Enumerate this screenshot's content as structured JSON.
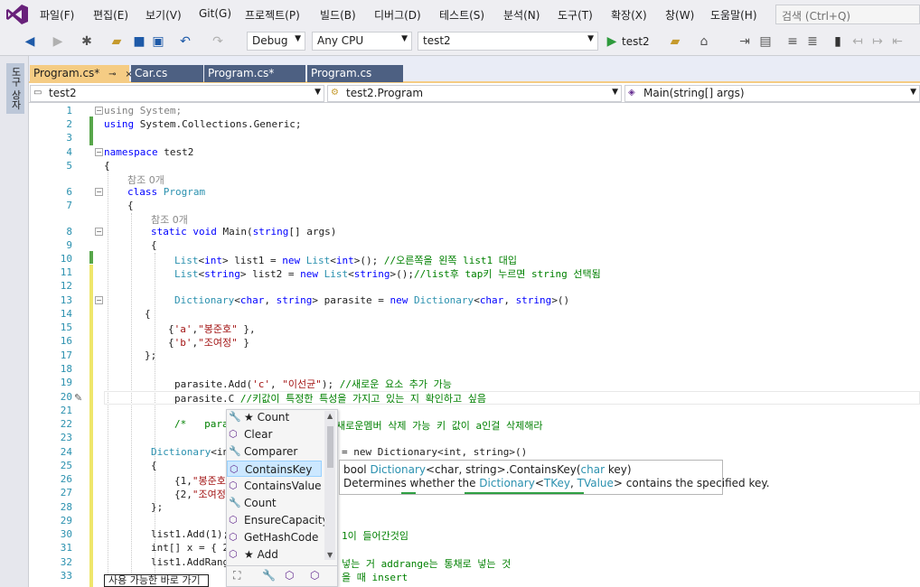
{
  "app": {
    "name": "Visual Studio"
  },
  "menu": {
    "items": [
      "파일(F)",
      "편집(E)",
      "보기(V)",
      "Git(G)",
      "프로젝트(P)",
      "빌드(B)",
      "디버그(D)",
      "테스트(S)",
      "분석(N)",
      "도구(T)",
      "확장(X)",
      "창(W)",
      "도움말(H)"
    ],
    "search_placeholder": "검색 (Ctrl+Q)"
  },
  "toolbar": {
    "config": "Debug",
    "platform": "Any CPU",
    "startup_project": "test2",
    "run_label": "test2"
  },
  "left_tool_window": {
    "label": "도구 상자"
  },
  "tabs": [
    {
      "label": "Program.cs*",
      "pin": "⊸",
      "close": "×",
      "active": true
    },
    {
      "label": "Car.cs",
      "active": false
    },
    {
      "label": "Program.cs*",
      "active": false
    },
    {
      "label": "Program.cs",
      "active": false
    }
  ],
  "nav": {
    "project": "test2",
    "type": "test2.Program",
    "member": "Main(string[] args)"
  },
  "code": {
    "line_numbers": [
      "1",
      "2",
      "3",
      "4",
      "5",
      "6",
      "7",
      "8",
      "9",
      "10",
      "11",
      "12",
      "13",
      "14",
      "15",
      "16",
      "17",
      "18",
      "19",
      "20",
      "21",
      "22",
      "23",
      "24",
      "25",
      "26",
      "27",
      "28",
      "29",
      "30",
      "31",
      "32",
      "33"
    ],
    "ref_count": "참조 0개",
    "l1_kw": "using",
    "l1_rest": " System;",
    "l2_kw": "using",
    "l2_rest": " System.Collections.Generic;",
    "l4_kw": "namespace",
    "l4_rest": " test2",
    "brace_open": "{",
    "brace_close": "}",
    "brace_close_semi": "};",
    "l6_kw": "class",
    "l6_ty": " Program",
    "l8_a": "static",
    "l8_b": " void",
    "l8_c": " Main(",
    "l8_d": "string",
    "l8_e": "[] args)",
    "l10_a": "List",
    "l10_b": "<",
    "l10_c": "int",
    "l10_d": "> list1 = ",
    "l10_e": "new",
    "l10_f": " List",
    "l10_g": "<",
    "l10_h": "int",
    "l10_i": ">(); ",
    "l10_cm": "//오른쪽을 왼쪽 list1 대입",
    "l11_a": "List",
    "l11_b": "<",
    "l11_c": "string",
    "l11_d": "> list2 = ",
    "l11_e": "new",
    "l11_f": " List",
    "l11_g": "<",
    "l11_h": "string",
    "l11_i": ">();",
    "l11_cm": "//list후 tap키 누르면 string 선택됨",
    "l13_a": "Dictionary",
    "l13_b": "<",
    "l13_c": "char",
    "l13_d": ", ",
    "l13_e": "string",
    "l13_f": "> parasite = ",
    "l13_g": "new",
    "l13_h": " Dictionary",
    "l13_i": "<",
    "l13_j": "char",
    "l13_k": ", ",
    "l13_l": "string",
    "l13_m": ">()",
    "l15_a": "{",
    "l15_b": "'a'",
    "l15_c": ",",
    "l15_d": "\"봉준호\"",
    "l15_e": " },",
    "l16_a": "{",
    "l16_b": "'b'",
    "l16_c": ",",
    "l16_d": "\"조여정\"",
    "l16_e": " }",
    "l19_a": "parasite.",
    "l19_b": "Add",
    "l19_c": "(",
    "l19_d": "'c'",
    "l19_e": ", ",
    "l19_f": "\"이선균\"",
    "l19_g": "); ",
    "l19_cm": "//새로운 요소 추가 가능",
    "l20_a": "parasite.C",
    "l20_cm": " //키값이 특정한 특성을 가지고 있는 지 확인하고 싶음",
    "l22_a": "/*   para",
    "l22_b": "새로운멤버 삭제 가능 키 값이 a인걸 삭제해라",
    "l24_a": "Dictionary",
    "l24_b": "<in",
    "l24_c": "= new Dictionary<int, string>()",
    "l25": "{",
    "l26_a": "{1,",
    "l26_b": "\"봉준호",
    "l27_a": "{2,",
    "l27_b": "\"조여정",
    "l28": "};",
    "l30_a": "list1.Add(1);",
    "l30_b": "1이 들어간것임",
    "l31_a": "int[] x = { 2",
    "l32_a": "list1.AddRang",
    "l32_b": "넣는 거 addrange는 통채로 넣는 것",
    "l33_b": "을 때 insert"
  },
  "completion": {
    "items": [
      {
        "label": "Count",
        "star": true,
        "icon": "wrench-icon"
      },
      {
        "label": "Clear",
        "icon": "method-icon"
      },
      {
        "label": "Comparer",
        "icon": "wrench-icon"
      },
      {
        "label": "ContainsKey",
        "icon": "method-icon",
        "selected": true
      },
      {
        "label": "ContainsValue",
        "icon": "method-icon"
      },
      {
        "label": "Count",
        "icon": "wrench-icon"
      },
      {
        "label": "EnsureCapacity",
        "icon": "method-icon"
      },
      {
        "label": "GetHashCode",
        "icon": "method-icon"
      },
      {
        "label": "Add",
        "star": true,
        "icon": "method-icon"
      }
    ],
    "star_glyph": "★"
  },
  "tooltip": {
    "sig_a": "bool ",
    "sig_b": "Dictionary",
    "sig_c": "<char, string>",
    "sig_d": ".ContainsKey(",
    "sig_e": "char",
    "sig_f": " key)",
    "desc_a": "Determines whether the ",
    "desc_b": "Dictionary",
    "desc_c": "<",
    "desc_d": "TKey",
    "desc_e": ", ",
    "desc_f": "TValue",
    "desc_g": ">",
    "desc_h": " contains the specified key."
  },
  "quick_action": "사용 가능한 바로 가기",
  "colors": {
    "keyword": "#0000ff",
    "type": "#2b91af",
    "string": "#a31515",
    "comment": "#008000",
    "accent": "#68217a"
  }
}
